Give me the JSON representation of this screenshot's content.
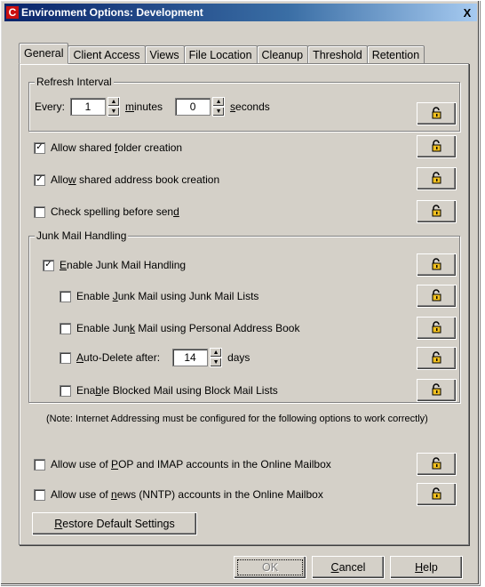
{
  "window": {
    "title": "Environment Options: Development",
    "close": "X"
  },
  "tabs": [
    "General",
    "Client Access",
    "Views",
    "File Location",
    "Cleanup",
    "Threshold",
    "Retention"
  ],
  "refresh": {
    "group_label": "Refresh Interval",
    "every_label": "Every:",
    "minutes_value": "1",
    "minutes_label": "minutes",
    "seconds_value": "0",
    "seconds_label": "seconds"
  },
  "options": {
    "shared_folder": {
      "label": "Allow shared folder creation",
      "checked": true
    },
    "shared_address_book": {
      "label": "Allow shared address book creation",
      "checked": true
    },
    "check_spelling": {
      "label": "Check spelling before send",
      "checked": false
    }
  },
  "junk": {
    "group_label": "Junk Mail Handling",
    "enable": {
      "label": "Enable Junk Mail Handling",
      "checked": true
    },
    "junk_lists": {
      "label": "Enable Junk Mail using Junk Mail Lists",
      "checked": false
    },
    "personal_book": {
      "label": "Enable Junk Mail using Personal Address Book",
      "checked": false
    },
    "auto_delete": {
      "label": "Auto-Delete after:",
      "checked": false,
      "value": "14",
      "unit": "days"
    },
    "blocked": {
      "label": "Enable Blocked Mail using Block Mail Lists",
      "checked": false
    }
  },
  "note": "(Note: Internet Addressing must be configured for the following options to work correctly)",
  "internet": {
    "pop_imap": {
      "label": "Allow use of POP and IMAP accounts in the Online Mailbox",
      "checked": false
    },
    "nntp": {
      "label": "Allow use of news (NNTP) accounts in the Online Mailbox",
      "checked": false
    }
  },
  "buttons": {
    "restore": "Restore Default Settings",
    "ok": "OK",
    "cancel": "Cancel",
    "help": "Help"
  },
  "icons": {
    "lock": "lock-icon",
    "check": "✓"
  }
}
